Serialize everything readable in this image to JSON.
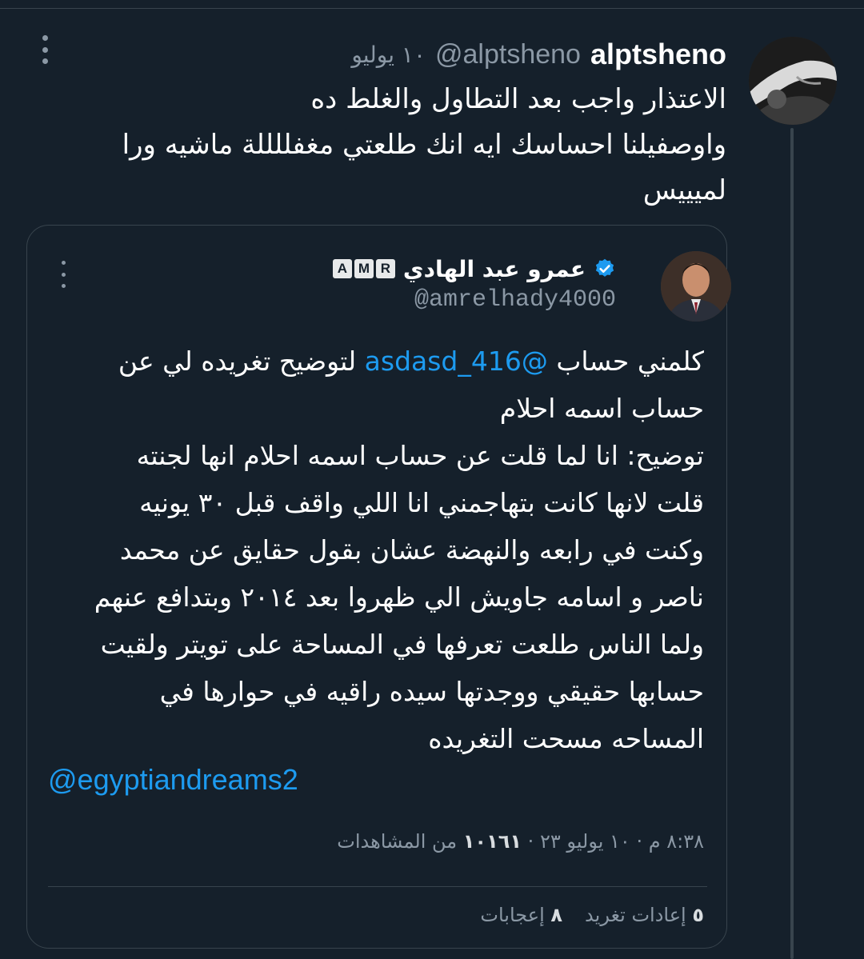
{
  "reply": {
    "display_name": "alptsheno",
    "handle": "@alptsheno",
    "date": "١٠ يوليو",
    "text_lines": [
      "الاعتذار واجب بعد التطاول والغلط ده",
      "واوصفيلنا احساسك ايه انك طلعتي مغفللللة ماشيه ورا",
      "لميييس"
    ]
  },
  "quoted": {
    "name": "عمرو عبد الهادي",
    "badge_letters": [
      "A",
      "M",
      "R"
    ],
    "handle": "@amrelhady4000",
    "text_line1_before": "كلمني حساب ",
    "text_line1_mention": "@asdasd_416",
    "text_line1_after": " لتوضيح تغريده لي عن",
    "text_lines": [
      "حساب اسمه احلام",
      "توضيح: انا لما قلت عن حساب اسمه احلام انها لجنته",
      "قلت لانها كانت بتهاجمني انا اللي واقف قبل ٣٠ يونيه",
      "وكنت في رابعه والنهضة عشان بقول حقايق عن محمد",
      "ناصر و اسامه جاويش الي ظهروا بعد ٢٠١٤ وبتدافع عنهم",
      "ولما الناس طلعت تعرفها في المساحة على تويتر ولقيت",
      "حسابها حقيقي ووجدتها سيده راقيه في حوارها في",
      "المساحه مسحت التغريده"
    ],
    "link": "@egyptiandreams2",
    "time": "٨:٣٨ م",
    "date": "١٠ يوليو ٢٣",
    "views_count": "١٠١٦١",
    "views_label": "من المشاهدات",
    "separator": "·",
    "retweets_count": "٥",
    "retweets_label": "إعادات تغريد",
    "likes_count": "٨",
    "likes_label": "إعجابات"
  },
  "icons": {
    "more": "more-vertical-icon",
    "verified": "verified-badge-icon"
  },
  "colors": {
    "background": "#15202b",
    "accent": "#1d9bf0",
    "muted": "#8b98a5",
    "border": "#38444d"
  }
}
